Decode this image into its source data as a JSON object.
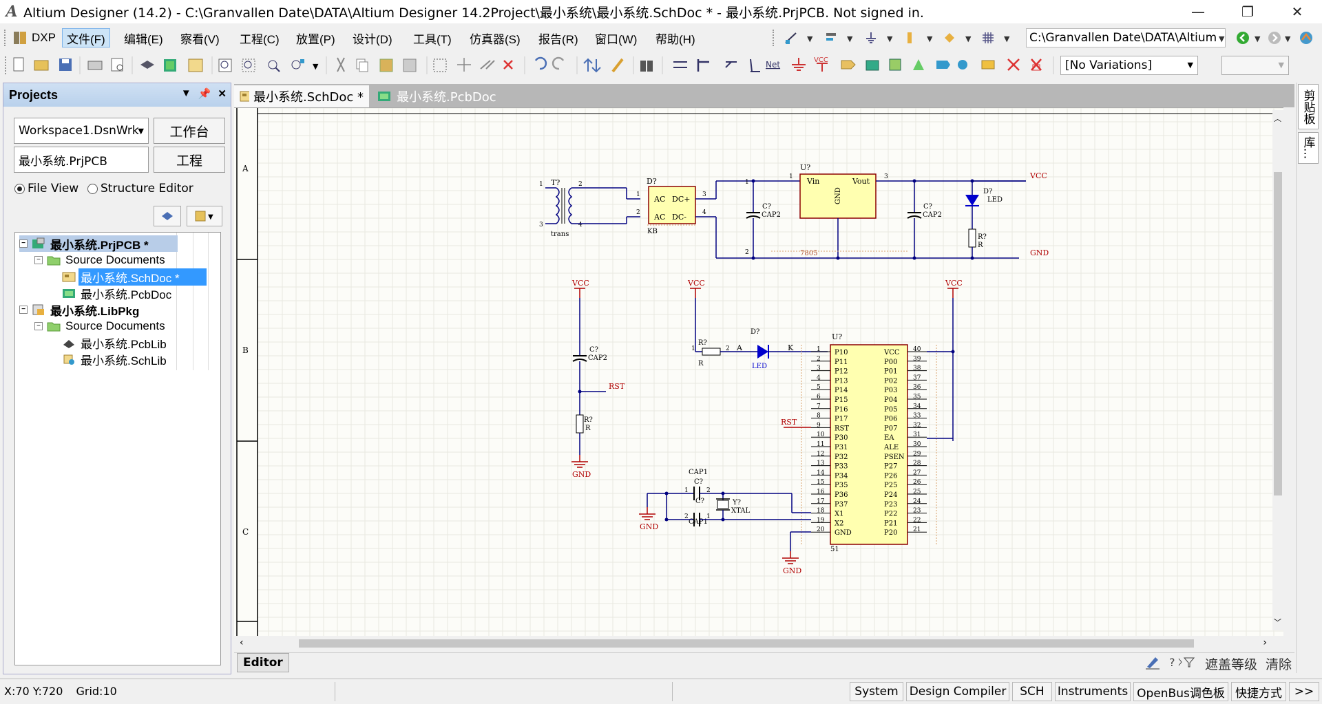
{
  "window": {
    "logo": "A",
    "title": "Altium Designer (14.2) - C:\\Granvallen Date\\DATA\\Altium Designer 14.2Project\\最小系统\\最小系统.SchDoc * - 最小系统.PrjPCB. Not signed in.",
    "minimize": "—",
    "restore": "❐",
    "close": "✕"
  },
  "menu": {
    "dxp": "DXP",
    "items": [
      "文件(F)",
      "编辑(E)",
      "察看(V)",
      "工程(C)",
      "放置(P)",
      "设计(D)",
      "工具(T)",
      "仿真器(S)",
      "报告(R)",
      "窗口(W)",
      "帮助(H)"
    ],
    "path": "C:\\Granvallen Date\\DATA\\Altium"
  },
  "toolbar2": {
    "variations": "[No Variations]",
    "empty_combo": ""
  },
  "projects": {
    "title": "Projects",
    "workspace": "Workspace1.DsnWrk",
    "workspace_btn": "工作台",
    "project": "最小系统.PrjPCB",
    "project_btn": "工程",
    "file_view": "File View",
    "structure_editor": "Structure Editor",
    "tree": [
      {
        "label": "最小系统.PrjPCB *",
        "level": 0,
        "exp": "−",
        "bold": true,
        "hl": true,
        "icon": "pcb-project-icon"
      },
      {
        "label": "Source Documents",
        "level": 1,
        "exp": "−",
        "icon": "folder-icon"
      },
      {
        "label": "最小系统.SchDoc *",
        "level": 2,
        "sel": true,
        "icon": "schdoc-icon"
      },
      {
        "label": "最小系统.PcbDoc",
        "level": 2,
        "icon": "pcbdoc-icon"
      },
      {
        "label": "最小系统.LibPkg",
        "level": 0,
        "exp": "−",
        "bold": true,
        "icon": "libpkg-icon"
      },
      {
        "label": "Source Documents",
        "level": 1,
        "exp": "−",
        "icon": "folder-icon"
      },
      {
        "label": "最小系统.PcbLib",
        "level": 2,
        "icon": "pcblib-icon"
      },
      {
        "label": "最小系统.SchLib",
        "level": 2,
        "icon": "schlib-icon"
      }
    ]
  },
  "tabs": {
    "schdoc": "最小系统.SchDoc *",
    "pcbdoc": "最小系统.PcbDoc"
  },
  "schematic": {
    "zone_labels": [
      "A",
      "B",
      "C"
    ],
    "labels": {
      "vcc": "VCC",
      "gnd": "GND",
      "rst": "RST",
      "trans_ref": "T?",
      "trans": "trans",
      "bridge_ref": "D?",
      "bridge_kb": "KB",
      "ac1": "AC",
      "ac2": "AC",
      "dcp": "DC+",
      "dcm": "DC-",
      "reg_ref": "U?",
      "vin": "Vin",
      "vout": "Vout",
      "reg_gnd": "GND",
      "reg_name": "7805",
      "cap_ref": "C?",
      "cap2": "CAP2",
      "cap1": "CAP1",
      "led_ref": "D?",
      "led": "LED",
      "res_ref": "R?",
      "res": "R",
      "anode": "A",
      "cathode": "K",
      "xtal_ref": "Y?",
      "xtal": "XTAL",
      "mcu_ref": "U?",
      "mcu_pin51": "51"
    },
    "mcu_left_pins": [
      "P10",
      "P11",
      "P12",
      "P13",
      "P14",
      "P15",
      "P16",
      "P17",
      "RST",
      "P30",
      "P31",
      "P32",
      "P33",
      "P34",
      "P35",
      "P36",
      "P37",
      "X1",
      "X2",
      "GND"
    ],
    "mcu_right_pins": [
      "VCC",
      "P00",
      "P01",
      "P02",
      "P03",
      "P04",
      "P05",
      "P06",
      "P07",
      "EA",
      "ALE",
      "PSEN",
      "P27",
      "P26",
      "P25",
      "P24",
      "P23",
      "P22",
      "P21",
      "P20"
    ],
    "mcu_right_nums": [
      "40",
      "39",
      "38",
      "37",
      "36",
      "35",
      "34",
      "33",
      "32",
      "31",
      "30",
      "29",
      "28",
      "27",
      "26",
      "25",
      "24",
      "23",
      "22",
      "21"
    ]
  },
  "editorbar": {
    "tab": "Editor",
    "mask_level": "遮盖等级",
    "clear": "清除"
  },
  "rightpanel": {
    "clipboard": "剪贴板",
    "lib": "库..."
  },
  "statusbar": {
    "coords": "X:70 Y:720",
    "grid": "Grid:10",
    "buttons": [
      "System",
      "Design Compiler",
      "SCH",
      "Instruments",
      "OpenBus调色板",
      "快捷方式",
      ">>"
    ]
  },
  "colors": {
    "wire": "#000080",
    "component_fill": "#ffffb0",
    "component_border": "#8b0000",
    "power_label": "#b00000",
    "grid": "#e8e8e0",
    "led_blue": "#0000cc"
  }
}
